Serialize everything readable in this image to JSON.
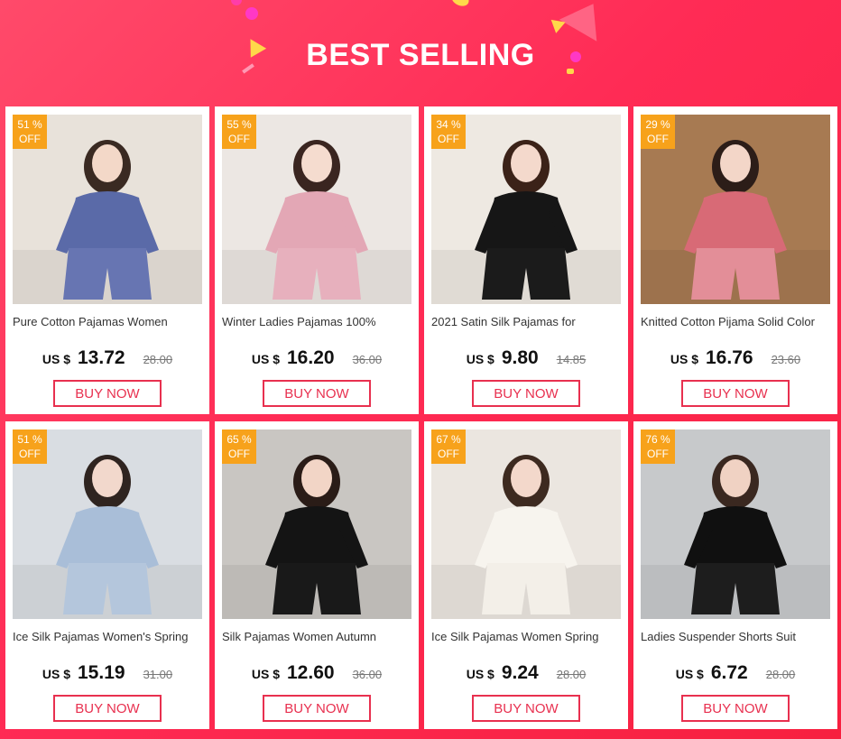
{
  "header": {
    "title": "BEST SELLING"
  },
  "colors": {
    "accent": "#e8304f",
    "badge": "#f7a21b",
    "background": "#ff2b55"
  },
  "products": [
    {
      "discount": "51 %",
      "off": "OFF",
      "name": "Pure Cotton Pajamas Women",
      "currency": "US $",
      "price": "13.72",
      "old_price": "28.00",
      "button": "BUY NOW",
      "photo": {
        "bg": "#e8e2da",
        "top": "#5a6aa8",
        "bottom": "#6775b2",
        "hair": "#3a2a22",
        "skin": "#f3d8c8"
      }
    },
    {
      "discount": "55 %",
      "off": "OFF",
      "name": "Winter Ladies Pajamas 100%",
      "currency": "US $",
      "price": "16.20",
      "old_price": "36.00",
      "button": "BUY NOW",
      "photo": {
        "bg": "#ece7e3",
        "top": "#e3a7b5",
        "bottom": "#e7b0bd",
        "hair": "#3a2520",
        "skin": "#f5dccf"
      }
    },
    {
      "discount": "34 %",
      "off": "OFF",
      "name": "2021 Satin Silk Pajamas for",
      "currency": "US $",
      "price": "9.80",
      "old_price": "14.85",
      "button": "BUY NOW",
      "photo": {
        "bg": "#eee9e2",
        "top": "#161616",
        "bottom": "#1b1b1b",
        "hair": "#3b2218",
        "skin": "#f4d9cc"
      }
    },
    {
      "discount": "29 %",
      "off": "OFF",
      "name": "Knitted Cotton Pijama Solid Color",
      "currency": "US $",
      "price": "16.76",
      "old_price": "23.60",
      "button": "BUY NOW",
      "photo": {
        "bg": "#a77a52",
        "top": "#d86a76",
        "bottom": "#e38e98",
        "hair": "#2c1d18",
        "skin": "#f3d6c8"
      }
    },
    {
      "discount": "51 %",
      "off": "OFF",
      "name": "Ice Silk Pajamas Women's Spring",
      "currency": "US $",
      "price": "15.19",
      "old_price": "31.00",
      "button": "BUY NOW",
      "photo": {
        "bg": "#d9dde2",
        "top": "#a9bed8",
        "bottom": "#b4c6dc",
        "hair": "#2f2420",
        "skin": "#f2d8cc"
      }
    },
    {
      "discount": "65 %",
      "off": "OFF",
      "name": "Silk Pajamas Women Autumn",
      "currency": "US $",
      "price": "12.60",
      "old_price": "36.00",
      "button": "BUY NOW",
      "photo": {
        "bg": "#c9c6c2",
        "top": "#141414",
        "bottom": "#191919",
        "hair": "#2a1c17",
        "skin": "#f2d5c6"
      }
    },
    {
      "discount": "67 %",
      "off": "OFF",
      "name": "Ice Silk Pajamas Women Spring",
      "currency": "US $",
      "price": "9.24",
      "old_price": "28.00",
      "button": "BUY NOW",
      "photo": {
        "bg": "#ebe6e0",
        "top": "#f7f4ee",
        "bottom": "#f3efe8",
        "hair": "#3d2a20",
        "skin": "#f3d8cb"
      }
    },
    {
      "discount": "76 %",
      "off": "OFF",
      "name": "Ladies Suspender Shorts Suit",
      "currency": "US $",
      "price": "6.72",
      "old_price": "28.00",
      "button": "BUY NOW",
      "photo": {
        "bg": "#c7c9cb",
        "top": "#101010",
        "bottom": "#1d1d1d",
        "hair": "#3a2820",
        "skin": "#f0d2c3"
      }
    }
  ]
}
